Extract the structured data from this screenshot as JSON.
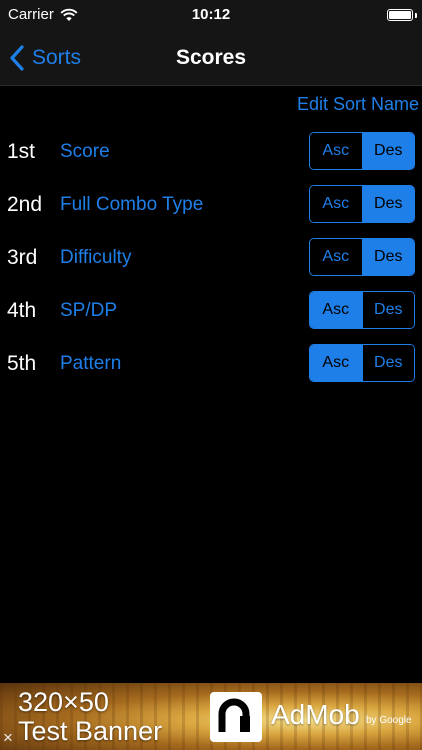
{
  "status_bar": {
    "carrier": "Carrier",
    "time": "10:12"
  },
  "nav": {
    "back_label": "Sorts",
    "title": "Scores"
  },
  "edit_sort_name": "Edit Sort Name",
  "sort_rows": [
    {
      "rank": "1st",
      "field": "Score",
      "asc_label": "Asc",
      "des_label": "Des",
      "selected": "Des"
    },
    {
      "rank": "2nd",
      "field": "Full Combo Type",
      "asc_label": "Asc",
      "des_label": "Des",
      "selected": "Des"
    },
    {
      "rank": "3rd",
      "field": "Difficulty",
      "asc_label": "Asc",
      "des_label": "Des",
      "selected": "Des"
    },
    {
      "rank": "4th",
      "field": "SP/DP",
      "asc_label": "Asc",
      "des_label": "Des",
      "selected": "Asc"
    },
    {
      "rank": "5th",
      "field": "Pattern",
      "asc_label": "Asc",
      "des_label": "Des",
      "selected": "Asc"
    }
  ],
  "ad": {
    "line1": "320×50",
    "line2": "Test Banner",
    "brand": "AdMob",
    "by": "by Google",
    "close_glyph": "×"
  },
  "colors": {
    "accent": "#1f7fe8",
    "background": "#000000",
    "bar": "#151515"
  }
}
